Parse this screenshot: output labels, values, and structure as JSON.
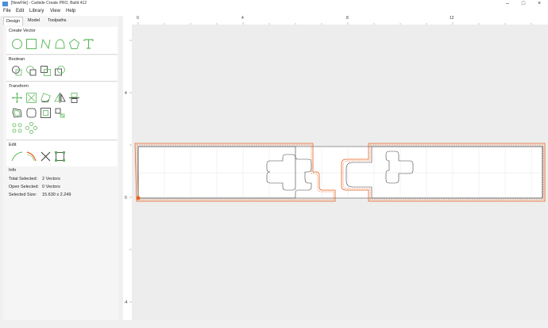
{
  "window": {
    "title": "[NewFile] - Carbide Create PRO, Build 412",
    "minimize_icon": "minimize-icon",
    "maximize_icon": "maximize-icon",
    "close_icon": "close-icon"
  },
  "menu": {
    "file": "File",
    "edit": "Edit",
    "library": "Library",
    "view": "View",
    "help": "Help"
  },
  "tabs": [
    "Design",
    "Model",
    "Toolpaths"
  ],
  "sections": {
    "create_vector": "Create Vector",
    "boolean": "Boolean",
    "transform": "Transform",
    "edit": "Edit",
    "info": "Info"
  },
  "info": {
    "total_selected_label": "Total Selected:",
    "total_selected_value": "2 Vectors",
    "open_selected_label": "Open Selected:",
    "open_selected_value": "0 Vectors",
    "selected_size_label": "Selected Size:",
    "selected_size_value": "15.630 x 2.249"
  },
  "rulers": {
    "h": [
      "0",
      "4",
      "8",
      "12"
    ],
    "v": [
      "4",
      "0",
      "-4"
    ]
  },
  "colors": {
    "tool_green": "#5cb85c",
    "toolpath_orange": "#e8601c",
    "selection": "#333333"
  }
}
